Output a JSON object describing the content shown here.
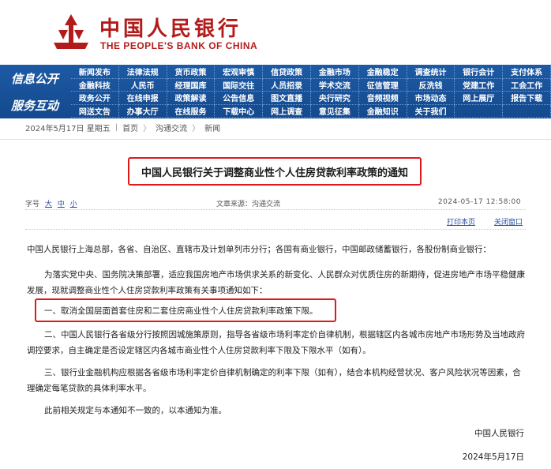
{
  "header": {
    "logo_cn": "中国人民银行",
    "logo_en": "THE PEOPLE'S BANK OF CHINA",
    "logo_icon": "pboc-emblem-icon",
    "brand_color": "#b31b1b"
  },
  "nav": {
    "label_1": "信息公开",
    "label_2": "服务互动",
    "bar_color": "#1d5aa5",
    "items": [
      "新闻发布",
      "法律法规",
      "货币政策",
      "宏观审慎",
      "信贷政策",
      "金融市场",
      "金融稳定",
      "调查统计",
      "银行会计",
      "支付体系",
      "金融科技",
      "人民币",
      "经理国库",
      "国际交往",
      "人员招录",
      "学术交流",
      "征信管理",
      "反洗钱",
      "党建工作",
      "工会工作",
      "政务公开",
      "在线申报",
      "政策解读",
      "公告信息",
      "图文直播",
      "央行研究",
      "音频视频",
      "市场动态",
      "网上展厅",
      "报告下载",
      "网送文告",
      "办事大厅",
      "在线服务",
      "下载中心",
      "网上调查",
      "意见征集",
      "金融知识",
      "关于我们",
      "",
      ""
    ]
  },
  "breadcrumb": {
    "date": "2024年5月17日 星期五",
    "sep": "|",
    "items": [
      "首页",
      "沟通交流",
      "新闻"
    ],
    "arrow": "〉"
  },
  "article": {
    "title": "中国人民银行关于调整商业性个人住房贷款利率政策的通知",
    "fontsize_label": "字号",
    "fontsize_options": [
      "大",
      "中",
      "小"
    ],
    "source": "文章来源：沟通交流",
    "date": "2024-05-17 12:58:00",
    "print": "打印本页",
    "close": "关闭窗口",
    "p0": "中国人民银行上海总部，各省、自治区、直辖市及计划单列市分行；各国有商业银行，中国邮政储蓄银行，各股份制商业银行：",
    "p1": "为落实党中央、国务院决策部署，适应我国房地产市场供求关系的新变化、人民群众对优质住房的新期待，促进房地产市场平稳健康发展，现就调整商业性个人住房贷款利率政策有关事项通知如下：",
    "p2": "一、取消全国层面首套住房和二套住房商业性个人住房贷款利率政策下限。",
    "p3": "二、中国人民银行各省级分行按照因城施策原则，指导各省级市场利率定价自律机制，根据辖区内各城市房地产市场形势及当地政府调控要求，自主确定是否设定辖区内各城市商业性个人住房贷款利率下限及下限水平（如有）。",
    "p4": "三、银行业金融机构应根据各省级市场利率定价自律机制确定的利率下限（如有），结合本机构经营状况、客户风险状况等因素，合理确定每笔贷款的具体利率水平。",
    "p5": "此前相关规定与本通知不一致的，以本通知为准。",
    "sign_org": "中国人民银行",
    "sign_date": "2024年5月17日"
  },
  "highlight_color": "#e01a1a"
}
